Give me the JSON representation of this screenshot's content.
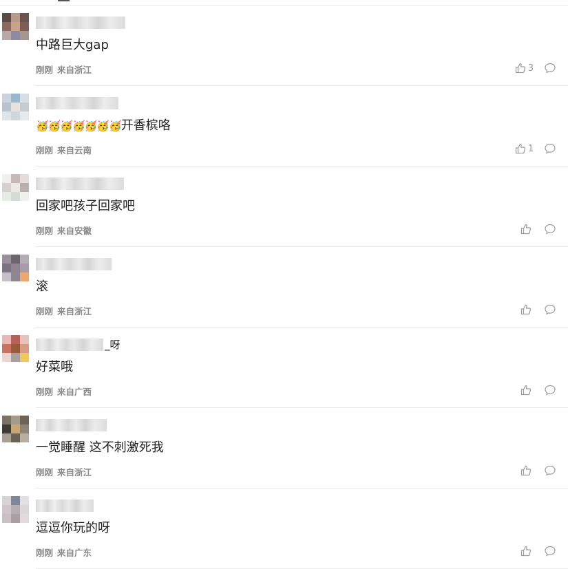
{
  "comments": [
    {
      "text": "中路巨大gap",
      "emoji": "",
      "name_suffix": "",
      "time": "刚刚",
      "location": "来自浙江",
      "likes": "3",
      "avatar_colors": [
        "#5d4a45",
        "#b79a8c",
        "#6b5450",
        "#8a6a5e",
        "#c9a08a",
        "#7d5e55",
        "#b8a8a8",
        "#8e8aa2",
        "#a79590"
      ]
    },
    {
      "text": "开香槟咯",
      "emoji": "🥳🥳🥳🥳🥳🥳🥳",
      "name_suffix": "",
      "time": "刚刚",
      "location": "来自云南",
      "likes": "1",
      "avatar_colors": [
        "#c9d3dc",
        "#9ab6c8",
        "#d6dde3",
        "#b7c4cf",
        "#e8e2dc",
        "#c5ccd3",
        "#dfe4e8",
        "#cfd6dc",
        "#e6e9ec"
      ]
    },
    {
      "text": "回家吧孩子回家吧",
      "emoji": "",
      "name_suffix": "",
      "time": "刚刚",
      "location": "来自安徽",
      "likes": "",
      "avatar_colors": [
        "#f2eeee",
        "#c8b8b8",
        "#e4dcdc",
        "#d7d0ce",
        "#ede7e5",
        "#b8b0ae",
        "#e4ece4",
        "#d3ddd3",
        "#eef0ee"
      ]
    },
    {
      "text": "滚",
      "emoji": "",
      "name_suffix": "",
      "time": "刚刚",
      "location": "来自浙江",
      "likes": "",
      "avatar_colors": [
        "#9a8f9c",
        "#6e6470",
        "#b5abb6",
        "#7c7280",
        "#8f8493",
        "#a79ba8",
        "#c5c0c8",
        "#8d8890",
        "#f0a56e"
      ]
    },
    {
      "text": "好菜哦",
      "emoji": "",
      "name_suffix": "_呀",
      "time": "刚刚",
      "location": "来自广西",
      "likes": "",
      "avatar_colors": [
        "#e9b8b4",
        "#b8615a",
        "#e6c2bd",
        "#c8735f",
        "#9d5a3a",
        "#d59b85",
        "#ead5d0",
        "#a8a0a0",
        "#f2c75a"
      ]
    },
    {
      "text": "一觉睡醒 这不刺激死我",
      "emoji": "",
      "name_suffix": "",
      "time": "刚刚",
      "location": "来自浙江",
      "likes": "",
      "avatar_colors": [
        "#7b7268",
        "#a39a8c",
        "#6d6458",
        "#3e3a36",
        "#c9a773",
        "#8e8576",
        "#a8a092",
        "#6a6254",
        "#b6ae9e"
      ]
    },
    {
      "text": "逗逗你玩的呀",
      "emoji": "",
      "name_suffix": "",
      "time": "刚刚",
      "location": "来自广东",
      "likes": "",
      "avatar_colors": [
        "#d9d3d6",
        "#7c8797",
        "#e3dfe2",
        "#cfc6cb",
        "#b8adb3",
        "#dcd6d9",
        "#c9bfc4",
        "#a99ea4",
        "#e0dadd"
      ]
    }
  ]
}
